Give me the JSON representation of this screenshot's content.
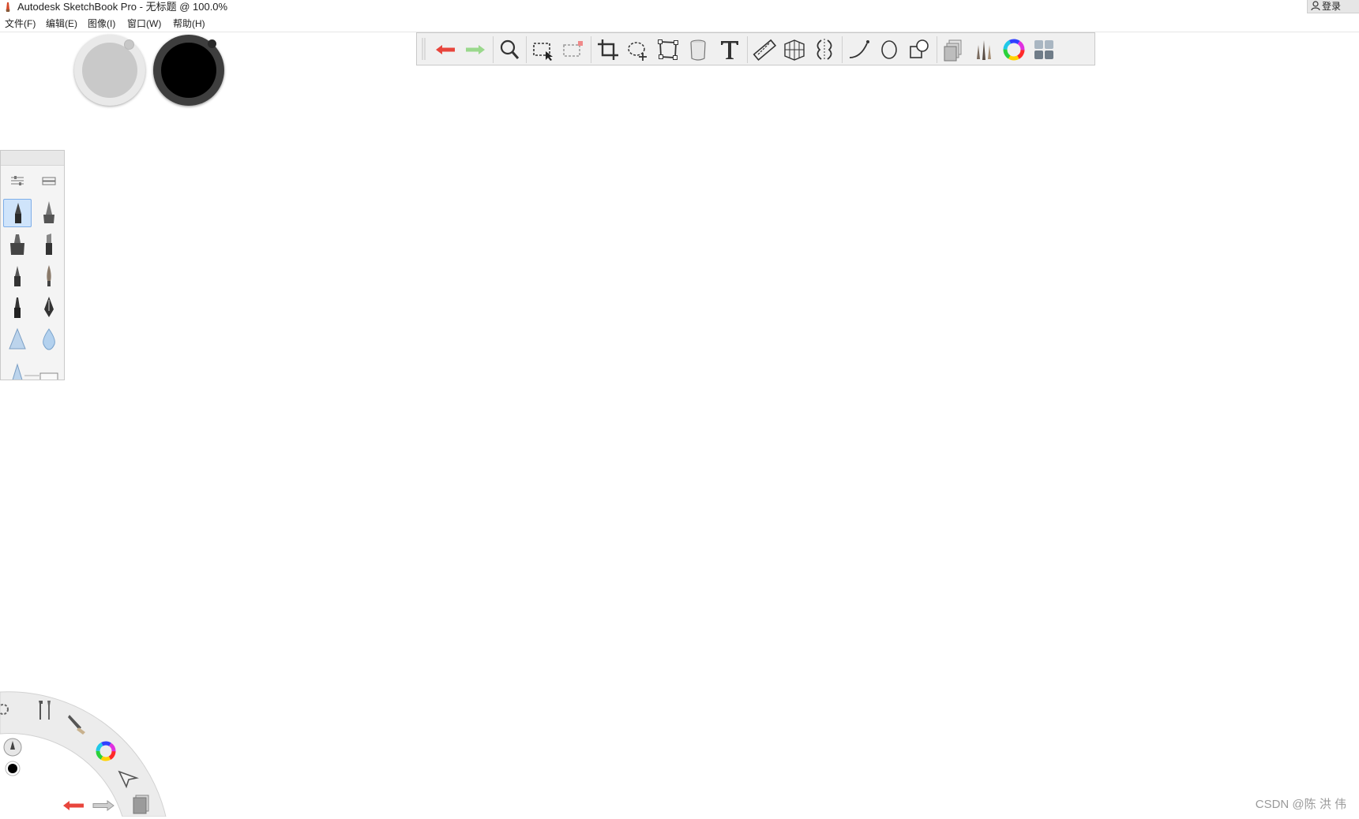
{
  "window": {
    "title": "Autodesk SketchBook Pro - 无标题 @ 100.0%",
    "login_label": "登录"
  },
  "menu": [
    {
      "label": "文件(F)"
    },
    {
      "label": "编辑(E)"
    },
    {
      "label": "图像(I)"
    },
    {
      "label": "窗口(W)"
    },
    {
      "label": "帮助(H)"
    }
  ],
  "colors": {
    "background": "#ffffff",
    "toolbar_bg": "#f0f0f0",
    "undo_red": "#e8453c",
    "redo_green": "#7ccf6a",
    "selected_brush_bg": "#cfe4fb",
    "primary_puck": "#000000",
    "secondary_puck": "#c9c9c9"
  },
  "toolbar": {
    "tools": [
      {
        "name": "undo",
        "icon": "undo-arrow-icon"
      },
      {
        "name": "redo",
        "icon": "redo-arrow-icon"
      },
      {
        "name": "zoom",
        "icon": "magnifier-icon"
      },
      {
        "name": "select",
        "icon": "rect-select-icon"
      },
      {
        "name": "clear-selection",
        "icon": "clear-select-icon"
      },
      {
        "name": "crop",
        "icon": "crop-icon"
      },
      {
        "name": "lasso-transform",
        "icon": "lasso-move-icon"
      },
      {
        "name": "distort",
        "icon": "distort-icon"
      },
      {
        "name": "fill",
        "icon": "bucket-icon"
      },
      {
        "name": "text",
        "icon": "text-icon"
      },
      {
        "name": "ruler",
        "icon": "ruler-icon"
      },
      {
        "name": "perspective",
        "icon": "perspective-grid-icon"
      },
      {
        "name": "symmetry",
        "icon": "symmetry-icon"
      },
      {
        "name": "curve",
        "icon": "curve-icon"
      },
      {
        "name": "ellipse",
        "icon": "ellipse-icon"
      },
      {
        "name": "shapes",
        "icon": "shapes-icon"
      },
      {
        "name": "layers",
        "icon": "layers-icon"
      },
      {
        "name": "brushes",
        "icon": "brushes-icon"
      },
      {
        "name": "color-wheel",
        "icon": "color-wheel-icon"
      },
      {
        "name": "copic",
        "icon": "swatches-icon"
      }
    ]
  },
  "brush_palette": {
    "header_icons": [
      "brush-settings-icon",
      "brush-library-icon"
    ],
    "brushes": [
      {
        "name": "pencil",
        "selected": true
      },
      {
        "name": "technical-pen",
        "selected": false
      },
      {
        "name": "marker",
        "selected": false
      },
      {
        "name": "chisel-marker",
        "selected": false
      },
      {
        "name": "ballpoint",
        "selected": false
      },
      {
        "name": "paintbrush",
        "selected": false
      },
      {
        "name": "felt-pen",
        "selected": false
      },
      {
        "name": "ink-pen",
        "selected": false
      },
      {
        "name": "airbrush",
        "selected": false
      },
      {
        "name": "water-drop",
        "selected": false
      },
      {
        "name": "triangle-brush",
        "selected": false
      },
      {
        "name": "eraser",
        "selected": false
      }
    ]
  },
  "lagoon": {
    "items": [
      "settings-gear-icon",
      "tools-icon",
      "brush-icon",
      "color-wheel-icon",
      "select-arrow-icon",
      "layers-icon",
      "undo-icon",
      "redo-icon",
      "brush-size-icon",
      "color-dot-icon"
    ]
  },
  "watermark": "CSDN @陈 洪 伟"
}
